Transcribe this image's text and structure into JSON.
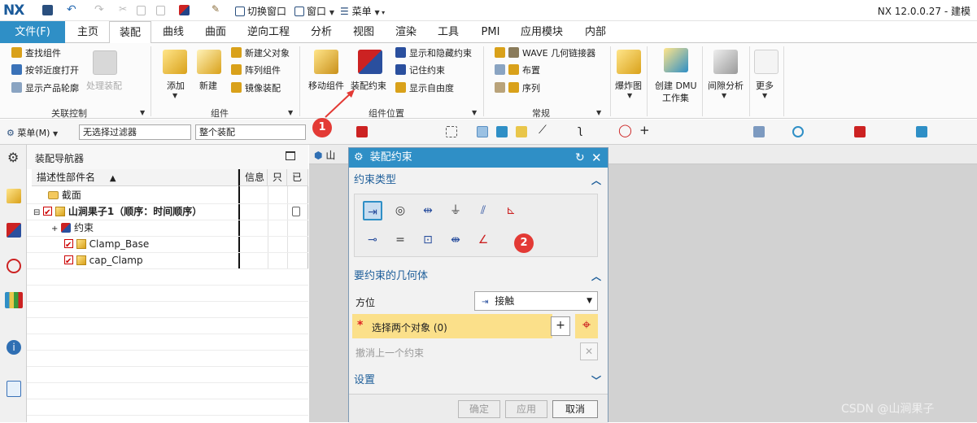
{
  "titlebar": {
    "logo": "NX",
    "switch_window": "切换窗口",
    "window": "窗口",
    "menu": "菜单",
    "app_title": "NX 12.0.0.27 - 建模"
  },
  "tabs": [
    "文件(F)",
    "主页",
    "装配",
    "曲线",
    "曲面",
    "逆向工程",
    "分析",
    "视图",
    "渲染",
    "工具",
    "PMI",
    "应用模块",
    "内部"
  ],
  "active_tab": "装配",
  "ribbon": {
    "find_component": "查找组件",
    "open_by_proximity": "按邻近度打开",
    "show_product_outline": "显示产品轮廓",
    "process_assembly": "处理装配",
    "group_association": "关联控制",
    "add": "添加",
    "new": "新建",
    "new_parent": "新建父对象",
    "array_component": "阵列组件",
    "mirror_assembly": "镜像装配",
    "group_component": "组件",
    "move_component": "移动组件",
    "assembly_constraint": "装配约束",
    "show_hide_constraint": "显示和隐藏约束",
    "remember_constraint": "记住约束",
    "show_dof": "显示自由度",
    "group_position": "组件位置",
    "wave_linker": "WAVE 几何链接器",
    "layout": "布置",
    "sequence": "序列",
    "group_general": "常规",
    "explosion": "爆炸图",
    "create_dmu": "创建 DMU",
    "dmu_sub": "工作集",
    "clearance": "间隙分析",
    "more": "更多"
  },
  "cmdbar": {
    "menu": "菜单(M)",
    "filter": "无选择过滤器",
    "scope": "整个装配"
  },
  "navigator": {
    "title": "装配导航器",
    "columns": [
      "描述性部件名",
      "信息",
      "只",
      "已"
    ],
    "rows": [
      {
        "name": "截面",
        "type": "folder"
      },
      {
        "name": "山涧果子1（顺序：时间顺序）",
        "type": "assembly",
        "bold": true
      },
      {
        "name": "约束",
        "type": "constraints"
      },
      {
        "name": "Clamp_Base",
        "type": "part"
      },
      {
        "name": "cap_Clamp",
        "type": "part"
      }
    ]
  },
  "gfx_tab": "山",
  "dialog": {
    "title": "装配约束",
    "sec_type": "约束类型",
    "sec_geometry": "要约束的几何体",
    "orientation_label": "方位",
    "orientation_value": "接触",
    "select_objects": "选择两个对象 (0)",
    "undo_last": "撤消上一个约束",
    "sec_settings": "设置",
    "ok": "确定",
    "apply": "应用",
    "cancel": "取消"
  },
  "badges": [
    "1",
    "2"
  ],
  "watermark": "CSDN @山涧果子",
  "colors": {
    "accent": "#2f8fc6",
    "badge": "#e33a35",
    "select_bg": "#fbe08a"
  }
}
